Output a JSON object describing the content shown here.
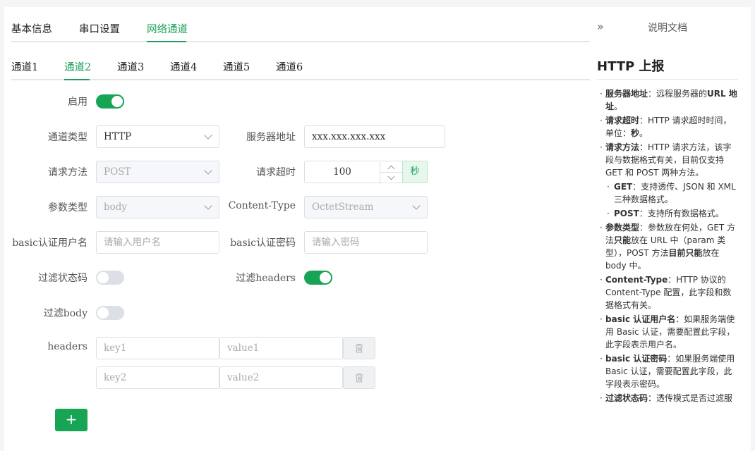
{
  "top_tabs": [
    {
      "label": "基本信息"
    },
    {
      "label": "串口设置"
    },
    {
      "label": "网络通道",
      "active": true
    }
  ],
  "channel_tabs": [
    {
      "label": "通道1"
    },
    {
      "label": "通道2",
      "active": true
    },
    {
      "label": "通道3"
    },
    {
      "label": "通道4"
    },
    {
      "label": "通道5"
    },
    {
      "label": "通道6"
    }
  ],
  "form": {
    "enable_label": "启用",
    "enable_on": true,
    "channel_type_label": "通道类型",
    "channel_type_value": "HTTP",
    "server_addr_label": "服务器地址",
    "server_addr_value": "xxx.xxx.xxx.xxx",
    "method_label": "请求方法",
    "method_value": "POST",
    "timeout_label": "请求超时",
    "timeout_value": "100",
    "timeout_unit": "秒",
    "param_type_label": "参数类型",
    "param_type_value": "body",
    "content_type_label": "Content-Type",
    "content_type_value": "OctetStream",
    "basic_user_label": "basic认证用户名",
    "basic_user_placeholder": "请输入用户名",
    "basic_pwd_label": "basic认证密码",
    "basic_pwd_placeholder": "请输入密码",
    "filter_status_label": "过滤状态码",
    "filter_status_on": false,
    "filter_headers_label": "过滤headers",
    "filter_headers_on": true,
    "filter_body_label": "过滤body",
    "filter_body_on": false,
    "headers_label": "headers",
    "headers": [
      {
        "key_placeholder": "key1",
        "value_placeholder": "value1"
      },
      {
        "key_placeholder": "key2",
        "value_placeholder": "value2"
      }
    ],
    "add_label": "+"
  },
  "doc": {
    "collapse_icon": "»",
    "title": "说明文档",
    "heading": "HTTP 上报"
  },
  "colors": {
    "accent": "#19a058",
    "toggle_on": "#17a454",
    "toggle_off": "#dcdfe6"
  }
}
